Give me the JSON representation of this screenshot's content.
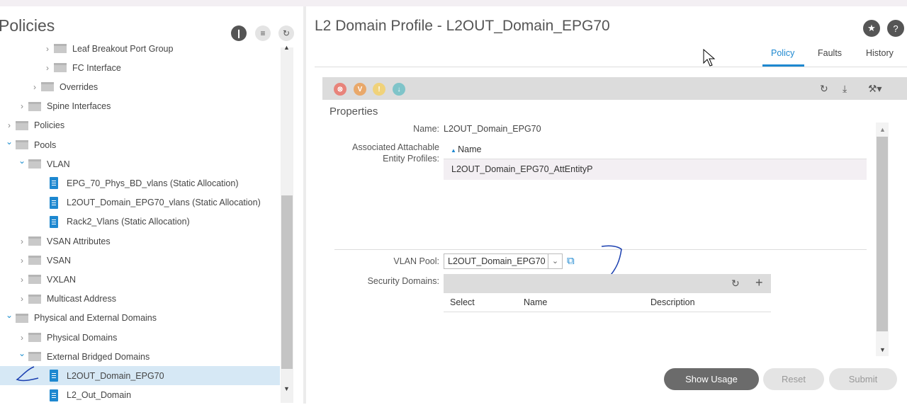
{
  "left_panel": {
    "title": "Policies",
    "tree": [
      {
        "label": "Leaf Breakout Port Group",
        "level": 3,
        "kind": "folder",
        "state": "collapsed"
      },
      {
        "label": "FC Interface",
        "level": 3,
        "kind": "folder",
        "state": "collapsed"
      },
      {
        "label": "Overrides",
        "level": 2,
        "kind": "folder",
        "state": "collapsed"
      },
      {
        "label": "Spine Interfaces",
        "level": 1,
        "kind": "folder",
        "state": "collapsed"
      },
      {
        "label": "Policies",
        "level": 0,
        "kind": "folder",
        "state": "collapsed"
      },
      {
        "label": "Pools",
        "level": 0,
        "kind": "folder",
        "state": "expanded"
      },
      {
        "label": "VLAN",
        "level": 1,
        "kind": "folder",
        "state": "expanded"
      },
      {
        "label": "EPG_70_Phys_BD_vlans (Static Allocation)",
        "level": 2,
        "kind": "doc"
      },
      {
        "label": "L2OUT_Domain_EPG70_vlans (Static Allocation)",
        "level": 2,
        "kind": "doc"
      },
      {
        "label": "Rack2_Vlans (Static Allocation)",
        "level": 2,
        "kind": "doc"
      },
      {
        "label": "VSAN Attributes",
        "level": 1,
        "kind": "folder",
        "state": "collapsed"
      },
      {
        "label": "VSAN",
        "level": 1,
        "kind": "folder",
        "state": "collapsed"
      },
      {
        "label": "VXLAN",
        "level": 1,
        "kind": "folder",
        "state": "collapsed"
      },
      {
        "label": "Multicast Address",
        "level": 1,
        "kind": "folder",
        "state": "collapsed"
      },
      {
        "label": "Physical and External Domains",
        "level": 0,
        "kind": "folder",
        "state": "expanded"
      },
      {
        "label": "Physical Domains",
        "level": 1,
        "kind": "folder",
        "state": "collapsed"
      },
      {
        "label": "External Bridged Domains",
        "level": 1,
        "kind": "folder",
        "state": "expanded"
      },
      {
        "label": "L2OUT_Domain_EPG70",
        "level": 2,
        "kind": "doc",
        "selected": true
      },
      {
        "label": "L2_Out_Domain",
        "level": 2,
        "kind": "doc"
      }
    ]
  },
  "main": {
    "title": "L2 Domain Profile - L2OUT_Domain_EPG70",
    "tabs": [
      {
        "label": "Policy",
        "active": true
      },
      {
        "label": "Faults"
      },
      {
        "label": "History"
      }
    ],
    "properties_heading": "Properties",
    "name_label": "Name:",
    "name_value": "L2OUT_Domain_EPG70",
    "aaep_label_1": "Associated Attachable",
    "aaep_label_2": "Entity Profiles:",
    "aaep_col": "Name",
    "aaep_rows": [
      "L2OUT_Domain_EPG70_AttEntityP"
    ],
    "vlan_pool_label": "VLAN Pool:",
    "vlan_pool_value": "L2OUT_Domain_EPG70",
    "security_label": "Security Domains:",
    "security_cols": [
      "Select",
      "Name",
      "Description"
    ],
    "buttons": {
      "show_usage": "Show Usage",
      "reset": "Reset",
      "submit": "Submit"
    }
  },
  "colors": {
    "accent": "#1e88d0",
    "critical": "#e8837a",
    "major": "#e9a86a",
    "minor": "#f0d27a",
    "warning": "#7fc4c9"
  }
}
